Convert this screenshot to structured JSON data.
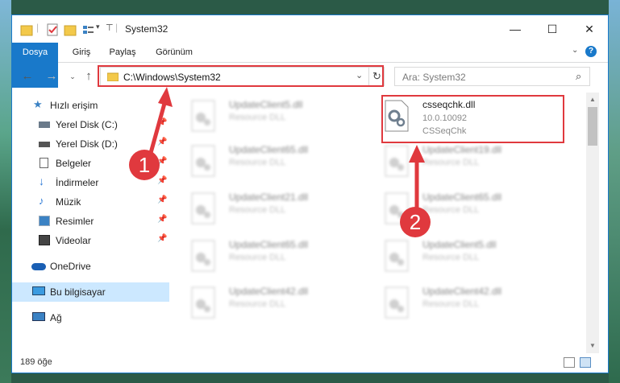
{
  "window": {
    "title": "System32",
    "controls": {
      "minimize": "—",
      "maximize": "☐",
      "close": "✕"
    }
  },
  "ribbon": {
    "tabs": [
      {
        "label": "Dosya",
        "active": true
      },
      {
        "label": "Giriş"
      },
      {
        "label": "Paylaş"
      },
      {
        "label": "Görünüm"
      }
    ],
    "expand_icon": "chevron-down-icon",
    "help_icon": "help-icon"
  },
  "navbar": {
    "address": "C:\\Windows\\System32",
    "search_placeholder": "Ara: System32"
  },
  "sidebar": {
    "items": [
      {
        "label": "Hızlı erişim",
        "icon": "star-icon",
        "pinned": false
      },
      {
        "label": "Yerel Disk (C:)",
        "icon": "drive-icon",
        "pinned": true
      },
      {
        "label": "Yerel Disk (D:)",
        "icon": "drive-icon",
        "pinned": true
      },
      {
        "label": "Belgeler",
        "icon": "documents-icon",
        "pinned": true
      },
      {
        "label": "İndirmeler",
        "icon": "download-icon",
        "pinned": true
      },
      {
        "label": "Müzik",
        "icon": "music-icon",
        "pinned": true
      },
      {
        "label": "Resimler",
        "icon": "pictures-icon",
        "pinned": true
      },
      {
        "label": "Videolar",
        "icon": "videos-icon",
        "pinned": true
      },
      {
        "label": "OneDrive",
        "icon": "onedrive-icon"
      },
      {
        "label": "Bu bilgisayar",
        "icon": "computer-icon",
        "selected": true
      },
      {
        "label": "Ağ",
        "icon": "network-icon"
      }
    ]
  },
  "files": {
    "left": [
      {
        "name": "UpdateClient5.dll",
        "type": "Resource DLL"
      },
      {
        "name": "UpdateClient65.dll",
        "type": "Resource DLL"
      },
      {
        "name": "UpdateClient21.dll",
        "type": "Resource DLL"
      },
      {
        "name": "UpdateClient65.dll",
        "type": "Resource DLL"
      },
      {
        "name": "UpdateClient42.dll",
        "type": "Resource DLL"
      }
    ],
    "highlight": {
      "name": "csseqchk.dll",
      "version": "10.0.10092",
      "description": "CSSeqChk"
    },
    "right": [
      {
        "name": "UpdateClient19.dll",
        "type": "Resource DLL"
      },
      {
        "name": "UpdateClient65.dll",
        "type": "Resource DLL"
      },
      {
        "name": "UpdateClient5.dll",
        "type": "Resource DLL"
      },
      {
        "name": "UpdateClient42.dll",
        "type": "Resource DLL"
      }
    ]
  },
  "status": {
    "count": "189 öğe"
  },
  "annotations": {
    "badge1": "1",
    "badge2": "2",
    "accent": "#e0393e"
  }
}
